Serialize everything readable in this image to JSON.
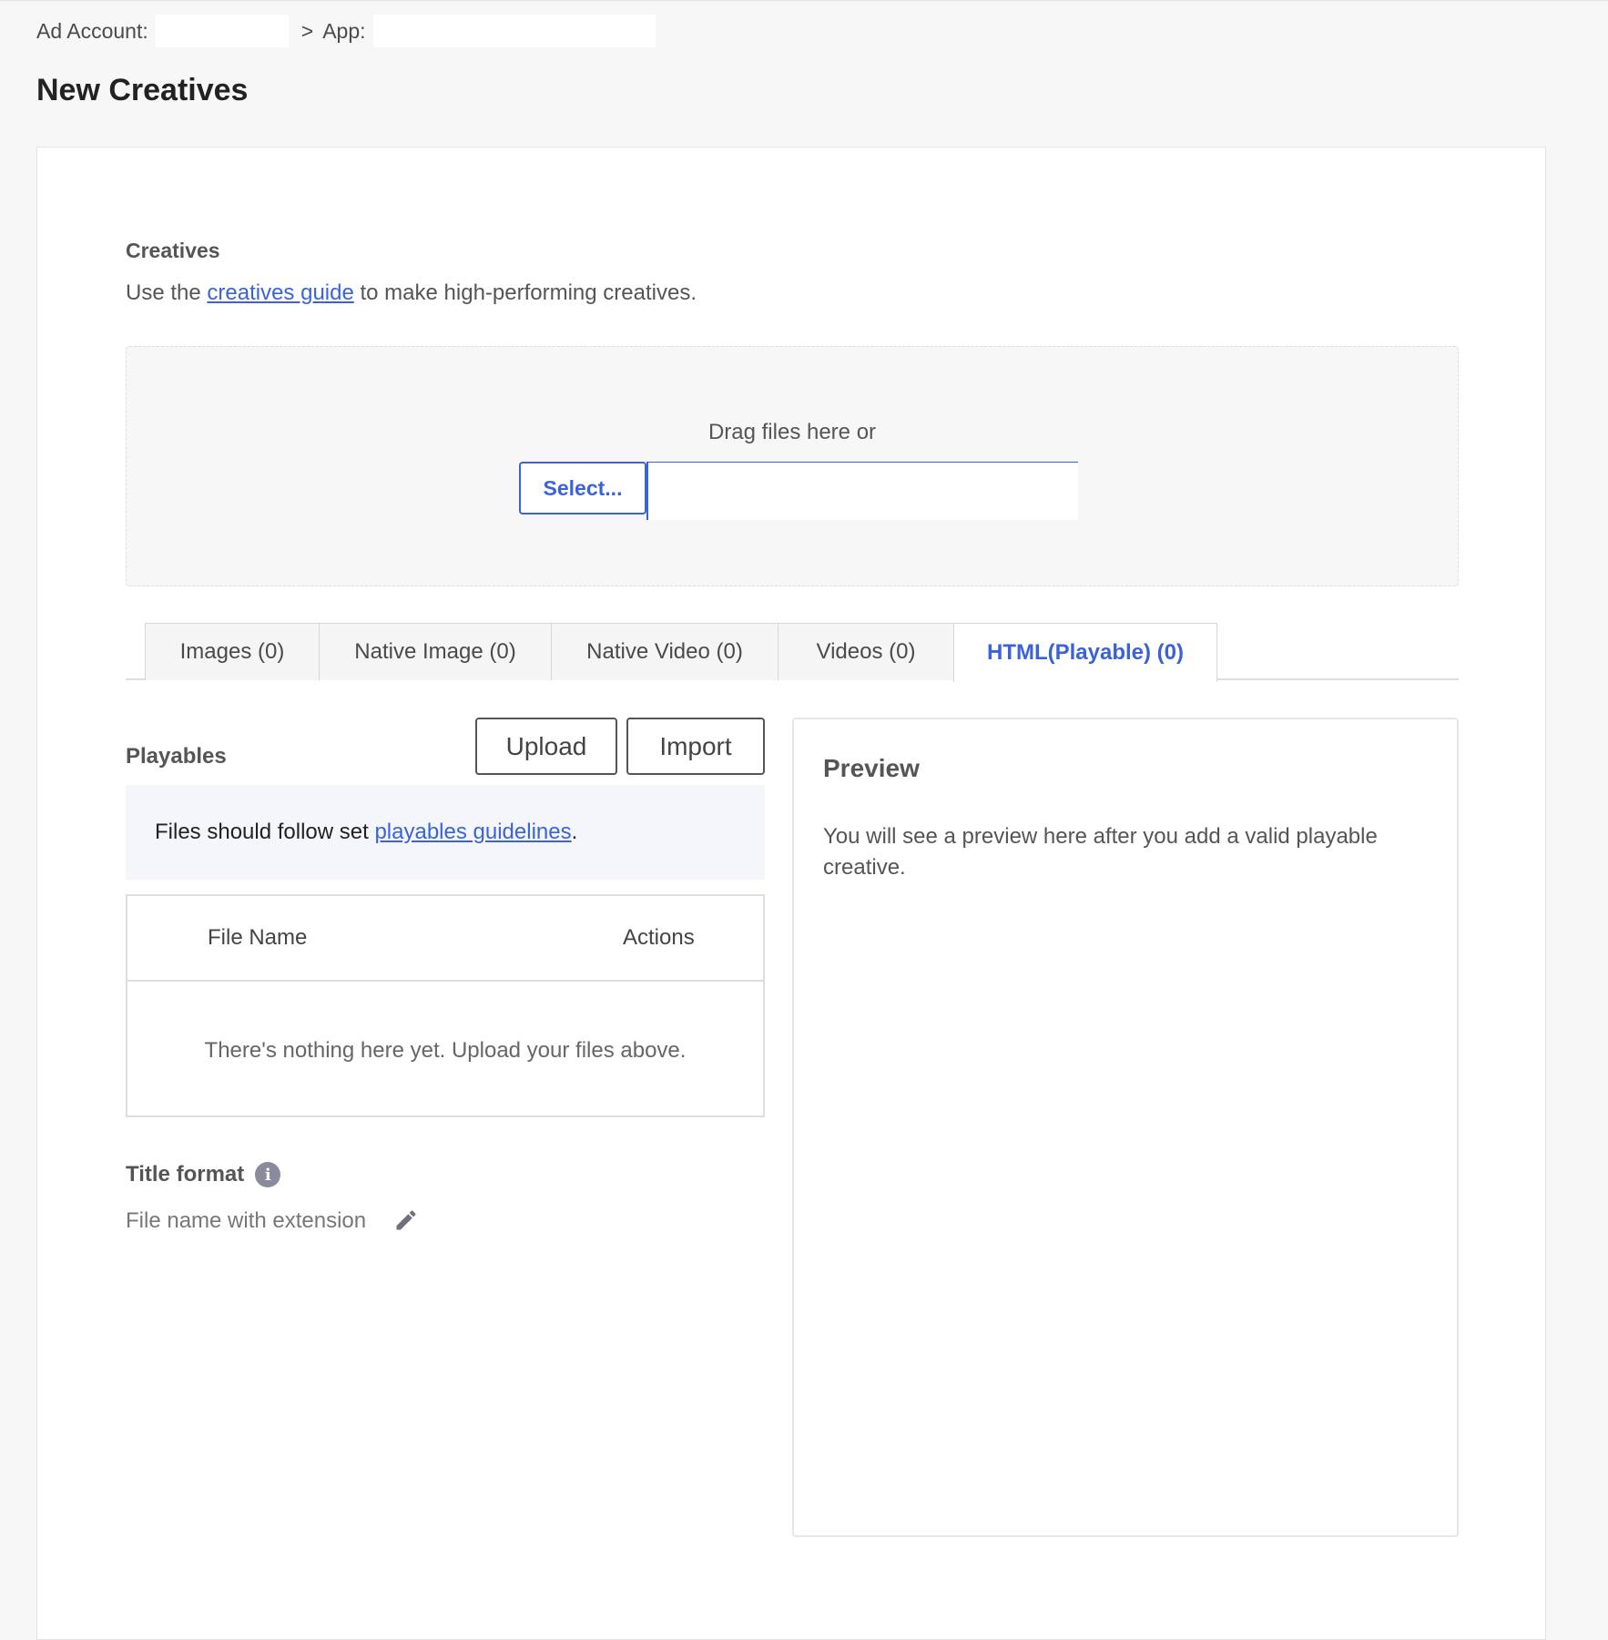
{
  "breadcrumb": {
    "ad_account_label": "Ad Account:",
    "separator": ">",
    "app_label": "App:"
  },
  "page": {
    "title": "New Creatives"
  },
  "creatives": {
    "label": "Creatives",
    "desc_prefix": "Use the",
    "guide_link": "creatives guide",
    "desc_suffix": "to make high-performing creatives."
  },
  "dropzone": {
    "text": "Drag files here or",
    "select_label": "Select..."
  },
  "tabs": [
    {
      "label": "Images (0)",
      "active": false
    },
    {
      "label": "Native Image (0)",
      "active": false
    },
    {
      "label": "Native Video (0)",
      "active": false
    },
    {
      "label": "Videos (0)",
      "active": false
    },
    {
      "label": "HTML(Playable) (0)",
      "active": true
    }
  ],
  "playables": {
    "label": "Playables",
    "upload_label": "Upload",
    "import_label": "Import",
    "notice_prefix": "Files should follow set",
    "notice_link": "playables guidelines",
    "notice_suffix": "."
  },
  "file_table": {
    "col_file_name": "File Name",
    "col_actions": "Actions",
    "empty": "There's nothing here yet. Upload your files above."
  },
  "title_format": {
    "label": "Title format",
    "info_glyph": "i",
    "value": "File name with extension"
  },
  "preview": {
    "title": "Preview",
    "desc": "You will see a preview here after you add a valid playable creative."
  },
  "icons": {
    "info": "info-icon",
    "edit": "pencil-edit-icon"
  },
  "colors": {
    "accent": "#3a63d8",
    "background": "#f7f7f7",
    "notice_bg": "#f5f6fb"
  }
}
